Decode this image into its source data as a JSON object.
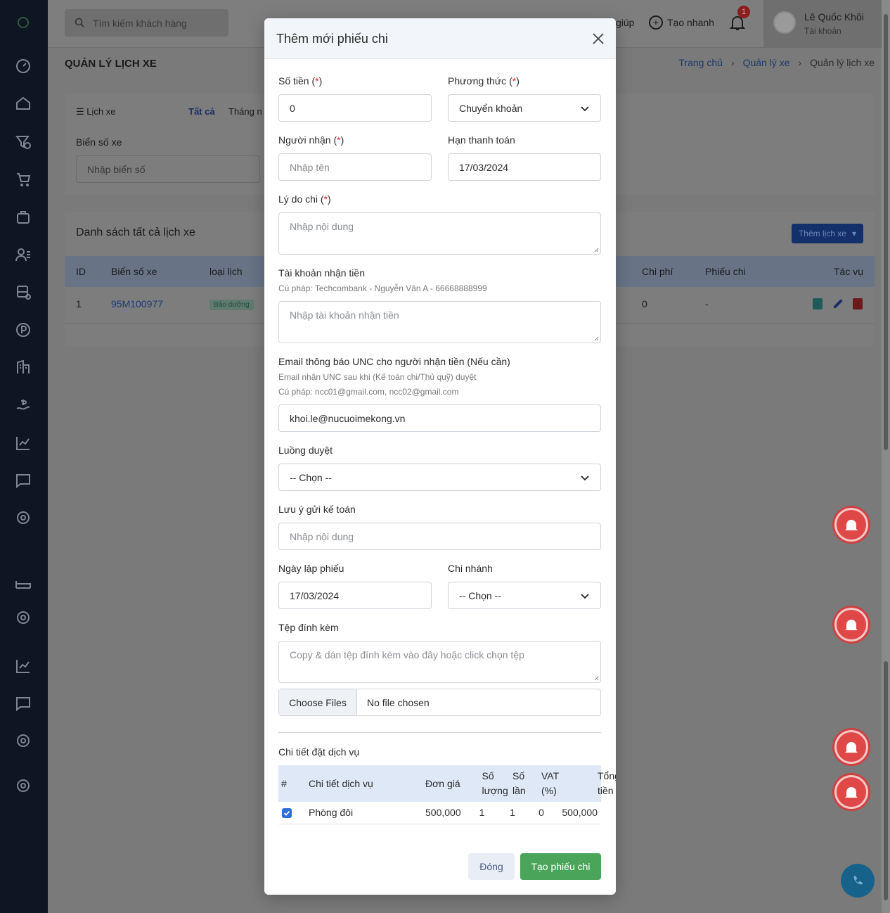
{
  "colors": {
    "primary": "#2b6fd6",
    "success": "#4aa55a",
    "danger": "#e0232b",
    "sidebar": "#0e1624"
  },
  "topbar": {
    "search_placeholder": "Tìm kiếm khách hàng",
    "help_label": "giúp",
    "quick_create_label": "Tạo nhanh",
    "notification_count": "1",
    "user_name": "Lê Quốc Khôi",
    "user_sub": "Tài khoản"
  },
  "page": {
    "title": "QUẢN LÝ LỊCH XE",
    "breadcrumb": [
      "Trang chủ",
      "Quản lý xe",
      "Quản lý lịch xe"
    ]
  },
  "filter": {
    "tab_schedule": "Lịch xe",
    "tab_all": "Tất cả",
    "tab_month": "Tháng n",
    "plate_label": "Biển số xe",
    "plate_placeholder": "Nhập biển số"
  },
  "list": {
    "title": "Danh sách tất cả lịch xe",
    "add_button": "Thêm lịch xe",
    "columns": [
      "ID",
      "Biển số xe",
      "loại lịch",
      "Chi phí",
      "Phiếu chi",
      "Tác vụ"
    ],
    "rows": [
      {
        "id": "1",
        "plate": "95M100977",
        "type": "Bảo dưỡng",
        "cost": "0",
        "voucher": "-"
      }
    ]
  },
  "modal": {
    "title": "Thêm mới phiếu chi",
    "amount_label": "Số tiền",
    "amount_value": "0",
    "method_label": "Phương thức",
    "method_value": "Chuyển khoản",
    "receiver_label": "Người nhận",
    "receiver_placeholder": "Nhập tên",
    "due_label": "Hạn thanh toán",
    "due_value": "17/03/2024",
    "reason_label": "Lý do chi",
    "reason_placeholder": "Nhập nội dung",
    "account_label": "Tài khoản nhận tiền",
    "account_hint": "Cú pháp: Techcombank - Nguyễn Văn A - 66668888999",
    "account_placeholder": "Nhập tài khoản nhận tiền",
    "email_label": "Email thông báo UNC cho người nhận tiền (Nếu cần)",
    "email_hint1": "Email nhận UNC sau khi (Kế toán chi/Thủ quỹ) duyệt",
    "email_hint2": "Cú pháp: ncc01@gmail.com, ncc02@gmail.com",
    "email_value": "khoi.le@nucuoimekong.vn",
    "flow_label": "Luồng duyệt",
    "flow_value": "-- Chọn --",
    "note_label": "Lưu ý gửi kế toán",
    "note_placeholder": "Nhập nội dung",
    "created_label": "Ngày lập phiếu",
    "created_value": "17/03/2024",
    "branch_label": "Chi nhánh",
    "branch_value": "-- Chọn --",
    "attach_label": "Tệp đính kèm",
    "attach_placeholder": "Copy & dán tệp đính kèm vào đây hoặc click chọn tệp",
    "file_button": "Choose Files",
    "file_status": "No file chosen",
    "required_mark": "*",
    "services_title": "Chi tiết đặt dịch vụ",
    "services_columns": {
      "no": "#",
      "detail": "Chi tiết dịch vụ",
      "price": "Đơn giá",
      "qty_1": "Số",
      "qty_2": "lượng",
      "times_1": "Số",
      "times_2": "lần",
      "vat_1": "VAT",
      "vat_2": "(%)",
      "total_1": "Tổng",
      "total_2": "tiền"
    },
    "services_rows": [
      {
        "name": "Phòng đôi",
        "price": "500,000",
        "qty": "1",
        "times": "1",
        "vat": "0",
        "total": "500,000"
      }
    ],
    "close_button": "Đóng",
    "create_button": "Tạo phiếu chi"
  }
}
